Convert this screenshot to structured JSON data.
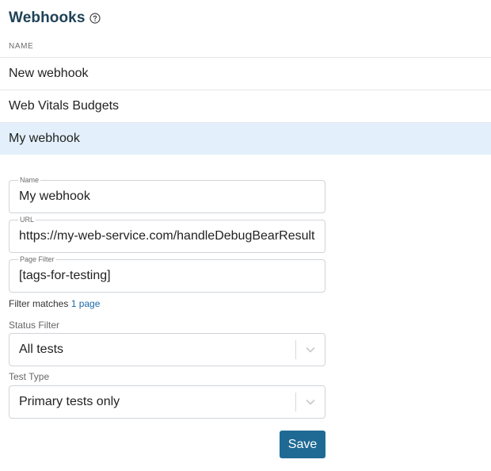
{
  "header": {
    "title": "Webhooks",
    "help_icon": "question-circle-icon"
  },
  "list": {
    "column_header": "NAME",
    "items": [
      {
        "name": "New webhook"
      },
      {
        "name": "Web Vitals Budgets"
      },
      {
        "name": "My webhook"
      }
    ],
    "selected_index": 2
  },
  "form": {
    "name": {
      "label": "Name",
      "value": "My webhook"
    },
    "url": {
      "label": "URL",
      "value": "https://my-web-service.com/handleDebugBearResult"
    },
    "page_filter": {
      "label": "Page Filter",
      "value": "[tags-for-testing]"
    },
    "filter_matches": {
      "prefix": "Filter matches",
      "link": "1 page"
    },
    "status_filter": {
      "label": "Status Filter",
      "value": "All tests"
    },
    "test_type": {
      "label": "Test Type",
      "value": "Primary tests only"
    },
    "save_label": "Save"
  },
  "colors": {
    "title": "#1f4257",
    "selected_row_bg": "#e3f0fb",
    "link": "#1a69a8",
    "save_button_bg": "#1f6a94"
  }
}
